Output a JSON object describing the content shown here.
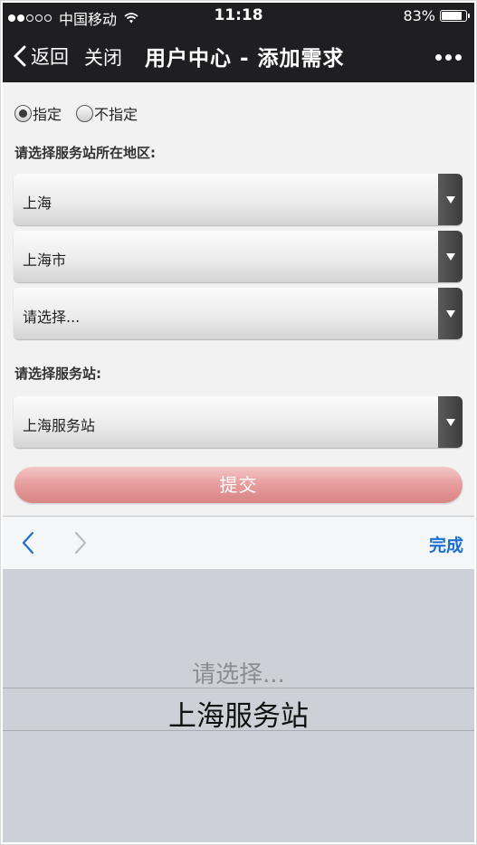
{
  "status_bar": {
    "carrier": "中国移动",
    "time": "11:18",
    "battery_percent": "83%",
    "battery_level": 0.83,
    "signal_icon": "signal-dots-icon",
    "wifi_icon": "wifi-icon"
  },
  "nav": {
    "back_label": "返回",
    "close_label": "关闭",
    "title": "用户中心 - 添加需求",
    "more_icon": "more-dots-icon"
  },
  "form": {
    "radio_options": [
      {
        "label": "指定",
        "checked": true
      },
      {
        "label": "不指定",
        "checked": false
      }
    ],
    "region_label": "请选择服务站所在地区:",
    "province_value": "上海",
    "city_value": "上海市",
    "district_value": "请选择...",
    "station_label": "请选择服务站:",
    "station_value": "上海服务站",
    "submit_label": "提交"
  },
  "picker_toolbar": {
    "prev_icon": "chevron-left-icon",
    "next_icon": "chevron-right-icon",
    "done_label": "完成"
  },
  "picker": {
    "options": [
      "请选择...",
      "上海服务站"
    ],
    "selected": "上海服务站"
  },
  "colors": {
    "nav_background": "#1f1f21",
    "submit_button": "#e69b9b",
    "done_link": "#1a6fd0",
    "picker_background": "#cdd0d6"
  }
}
